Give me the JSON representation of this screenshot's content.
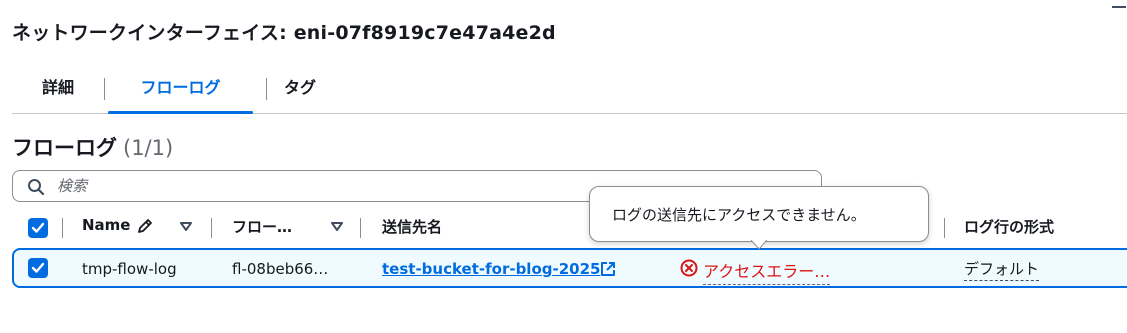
{
  "header": {
    "title": "ネットワークインターフェイス: eni-07f8919c7e47a4e2d"
  },
  "tabs": [
    {
      "label": "詳細",
      "active": false
    },
    {
      "label": "フローログ",
      "active": true
    },
    {
      "label": "タグ",
      "active": false
    }
  ],
  "flowlogs": {
    "heading": "フローログ",
    "count": "(1/1)",
    "search_placeholder": "検索",
    "columns": [
      "Name",
      "フロー…",
      "送信先名",
      "ログ行の形式"
    ],
    "rows": [
      {
        "selected": true,
        "name": "tmp-flow-log",
        "flow_log_id": "fl-08beb66…",
        "destination": "test-bucket-for-blog-2025",
        "status": "アクセスエラー…",
        "log_format": "デフォルト"
      }
    ],
    "tooltip": "ログの送信先にアクセスできません。"
  },
  "colors": {
    "accent": "#006ce0",
    "error": "#d91515",
    "text": "#16191f"
  },
  "icons": [
    "search-icon",
    "pencil-icon",
    "sort-down-icon",
    "external-link-icon",
    "error-circle-icon",
    "checkbox-checked-icon"
  ]
}
